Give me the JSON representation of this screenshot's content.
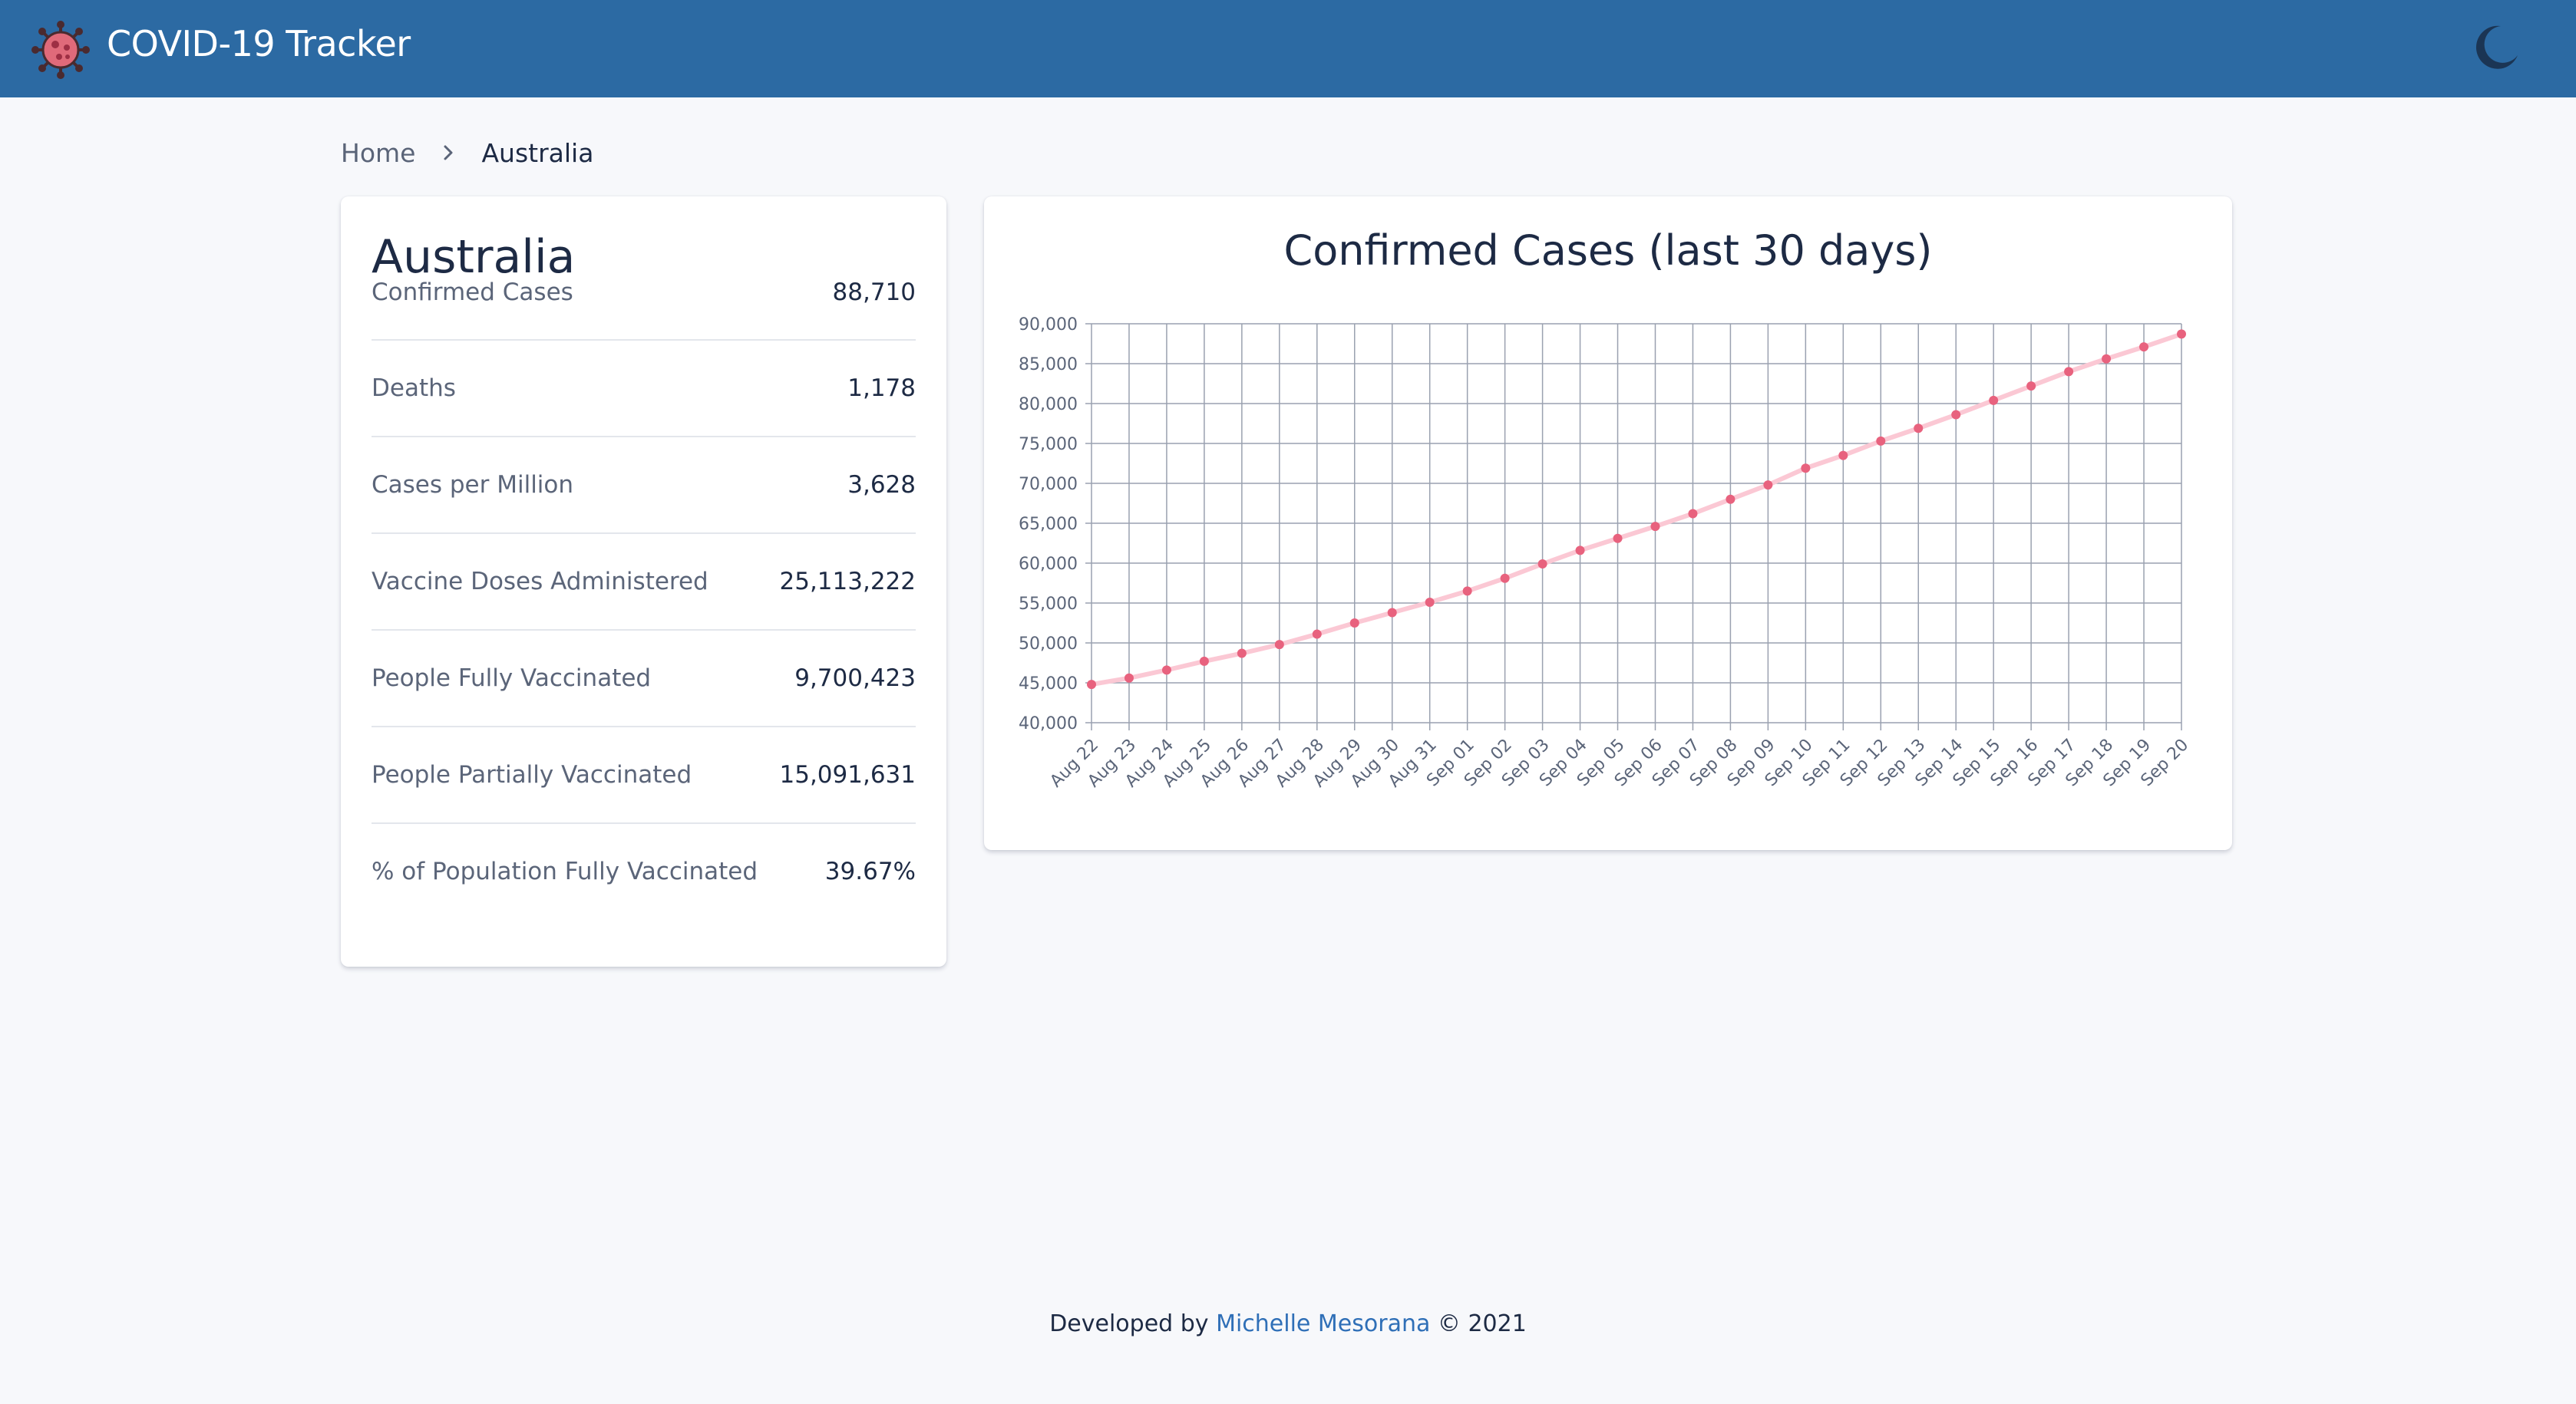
{
  "header": {
    "title": "COVID-19 Tracker",
    "logo_icon": "virus-icon",
    "theme_toggle_icon": "moon-icon",
    "brand_color": "#2c6aa3"
  },
  "breadcrumb": {
    "home_label": "Home",
    "separator_icon": "chevron-right-icon",
    "current_label": "Australia"
  },
  "stats": {
    "country": "Australia",
    "rows": [
      {
        "label": "Confirmed Cases",
        "value": "88,710"
      },
      {
        "label": "Deaths",
        "value": "1,178"
      },
      {
        "label": "Cases per Million",
        "value": "3,628"
      },
      {
        "label": "Vaccine Doses Administered",
        "value": "25,113,222"
      },
      {
        "label": "People Fully Vaccinated",
        "value": "9,700,423"
      },
      {
        "label": "People Partially Vaccinated",
        "value": "15,091,631"
      },
      {
        "label": "% of Population Fully Vaccinated",
        "value": "39.67%"
      }
    ]
  },
  "chart_data": {
    "type": "line",
    "title": "Confirmed Cases (last 30 days)",
    "xlabel": "",
    "ylabel": "",
    "categories": [
      "Aug 22",
      "Aug 23",
      "Aug 24",
      "Aug 25",
      "Aug 26",
      "Aug 27",
      "Aug 28",
      "Aug 29",
      "Aug 30",
      "Aug 31",
      "Sep 01",
      "Sep 02",
      "Sep 03",
      "Sep 04",
      "Sep 05",
      "Sep 06",
      "Sep 07",
      "Sep 08",
      "Sep 09",
      "Sep 10",
      "Sep 11",
      "Sep 12",
      "Sep 13",
      "Sep 14",
      "Sep 15",
      "Sep 16",
      "Sep 17",
      "Sep 18",
      "Sep 19",
      "Sep 20"
    ],
    "series": [
      {
        "values": [
          44800,
          45600,
          46600,
          47700,
          48700,
          49800,
          51100,
          52500,
          53800,
          55100,
          56500,
          58100,
          59900,
          61600,
          63100,
          64600,
          66200,
          68000,
          69800,
          71900,
          73500,
          75300,
          76900,
          78600,
          80400,
          82200,
          84000,
          85600,
          87100,
          88710
        ]
      }
    ],
    "ylim": [
      40000,
      90000
    ],
    "yticks": [
      "90,000",
      "85,000",
      "80,000",
      "75,000",
      "70,000",
      "65,000",
      "60,000",
      "55,000",
      "50,000",
      "45,000",
      "40,000"
    ],
    "line_color": "#fbc8d4",
    "point_color": "#e8627e",
    "grid": true,
    "legend": "none"
  },
  "footer": {
    "prefix": "Developed by",
    "author": "Michelle Mesorana",
    "suffix": "© 2021"
  }
}
